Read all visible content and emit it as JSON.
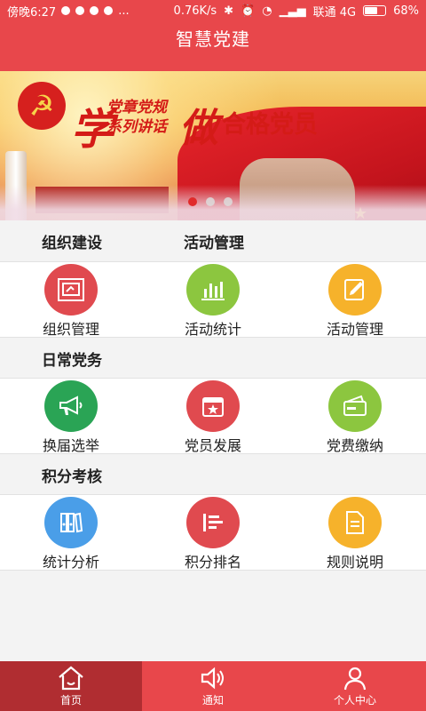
{
  "statusbar": {
    "time": "傍晚6:27",
    "more": "...",
    "speed": "0.76K/s",
    "carrier": "联通 4G",
    "battery": "68%",
    "battery_level": 0.68
  },
  "header": {
    "title": "智慧党建"
  },
  "banner": {
    "char1": "学",
    "line1": "党章党规",
    "line2": "系列讲话",
    "char2": "做",
    "line3": "合格党员",
    "slides": 3,
    "active_slide": 1
  },
  "sections": [
    {
      "titles": [
        "组织建设",
        "活动管理"
      ],
      "items": [
        {
          "label": "组织管理",
          "icon": "flag-board-icon",
          "color": "#e04a4f"
        },
        {
          "label": "活动统计",
          "icon": "bar-chart-icon",
          "color": "#8cc63f"
        },
        {
          "label": "活动管理",
          "icon": "edit-note-icon",
          "color": "#f6b22b"
        }
      ]
    },
    {
      "titles": [
        "日常党务"
      ],
      "items": [
        {
          "label": "换届选举",
          "icon": "megaphone-icon",
          "color": "#2aa455"
        },
        {
          "label": "党员发展",
          "icon": "calendar-star-icon",
          "color": "#e04a4f"
        },
        {
          "label": "党费缴纳",
          "icon": "wallet-card-icon",
          "color": "#8cc63f"
        }
      ]
    },
    {
      "titles": [
        "积分考核"
      ],
      "items": [
        {
          "label": "统计分析",
          "icon": "binders-icon",
          "color": "#4a9ee8"
        },
        {
          "label": "积分排名",
          "icon": "ranking-list-icon",
          "color": "#e04a4f"
        },
        {
          "label": "规则说明",
          "icon": "document-icon",
          "color": "#f6b22b"
        }
      ]
    }
  ],
  "tabs": [
    {
      "label": "首页",
      "icon": "home-icon",
      "active": true
    },
    {
      "label": "通知",
      "icon": "speaker-icon",
      "active": false
    },
    {
      "label": "个人中心",
      "icon": "user-icon",
      "active": false
    }
  ]
}
